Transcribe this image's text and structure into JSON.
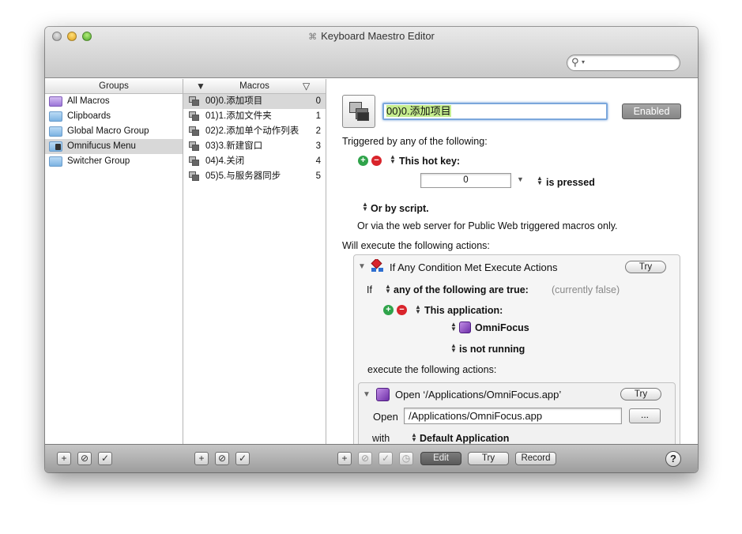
{
  "window": {
    "title": "Keyboard Maestro Editor",
    "title_icon": "⌘"
  },
  "search": {
    "placeholder": ""
  },
  "groups": {
    "header": "Groups",
    "items": [
      {
        "label": "All Macros",
        "icon": "purple-folder-icon"
      },
      {
        "label": "Clipboards",
        "icon": "folder-icon"
      },
      {
        "label": "Global Macro Group",
        "icon": "folder-icon"
      },
      {
        "label": "Omnifucus Menu",
        "icon": "folder-doc-icon",
        "selected": true
      },
      {
        "label": "Switcher Group",
        "icon": "folder-icon"
      }
    ]
  },
  "macros": {
    "header": "Macros",
    "items": [
      {
        "label": "00)0.添加项目",
        "num": "0",
        "selected": true
      },
      {
        "label": "01)1.添加文件夹",
        "num": "1"
      },
      {
        "label": "02)2.添加单个动作列表",
        "num": "2"
      },
      {
        "label": "03)3.新建窗口",
        "num": "3"
      },
      {
        "label": "04)4.关闭",
        "num": "4"
      },
      {
        "label": "05)5.与服务器同步",
        "num": "5"
      }
    ]
  },
  "editor": {
    "macro_name": "00)0.添加项目",
    "enabled_label": "Enabled",
    "triggered_by": "Triggered by any of the following:",
    "hot_key_label": "This hot key:",
    "hot_key_value": "0",
    "is_pressed": "is pressed",
    "or_by_script": "Or by script.",
    "web_server": "Or via the web server for Public Web triggered macros only.",
    "will_execute": "Will execute the following actions:",
    "action1": {
      "title": "If Any Condition Met Execute Actions",
      "try": "Try",
      "if_label": "If",
      "any_true": "any of the following are true:",
      "status": "(currently false)",
      "app_label": "This application:",
      "app_name": "OmniFocus",
      "not_running": "is not running",
      "execute": "execute the following actions:"
    },
    "action2": {
      "title": "Open ‘/Applications/OmniFocus.app’",
      "try": "Try",
      "open_label": "Open",
      "path": "/Applications/OmniFocus.app",
      "browse": "...",
      "with_label": "with",
      "with_app": "Default Application"
    }
  },
  "bottombar": {
    "edit": "Edit",
    "try": "Try",
    "record": "Record",
    "help": "?"
  }
}
